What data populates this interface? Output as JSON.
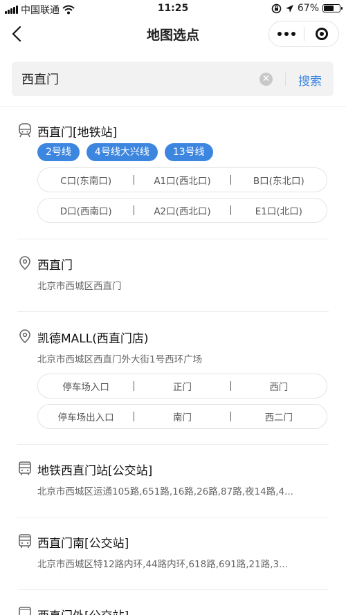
{
  "status_bar": {
    "carrier": "中国联通",
    "time": "11:25",
    "battery": "67%",
    "battery_level": 0.67
  },
  "nav": {
    "title": "地图选点"
  },
  "search": {
    "value": "西直门",
    "submit_label": "搜索"
  },
  "results": [
    {
      "name": "西直门[地铁站]",
      "icon": "subway-icon",
      "lines": [
        "2号线",
        "4号线大兴线",
        "13号线"
      ],
      "exits": [
        [
          "C口(东南口)",
          "A1口(西北口)",
          "B口(东北口)"
        ],
        [
          "D口(西南口)",
          "A2口(西北口)",
          "E1口(北口)"
        ]
      ]
    },
    {
      "name": "西直门",
      "icon": "location-pin-icon",
      "address": "北京市西城区西直门"
    },
    {
      "name": "凯德MALL(西直门店)",
      "icon": "location-pin-icon",
      "address": "北京市西城区西直门外大街1号西环广场",
      "entrances": [
        [
          "停车场入口",
          "正门",
          "西门"
        ],
        [
          "停车场出入口",
          "南门",
          "西二门"
        ]
      ]
    },
    {
      "name": "地铁西直门站[公交站]",
      "icon": "bus-icon",
      "address": "北京市西城区运通105路,651路,16路,26路,87路,夜14路,4..."
    },
    {
      "name": "西直门南[公交站]",
      "icon": "bus-icon",
      "address": "北京市西城区特12路内环,44路内环,618路,691路,21路,3..."
    },
    {
      "name": "西直门外[公交站]",
      "icon": "bus-icon"
    }
  ],
  "colors": {
    "accent": "#3d86e0",
    "divider": "#ececec",
    "search_bg": "#f2f2f2"
  }
}
